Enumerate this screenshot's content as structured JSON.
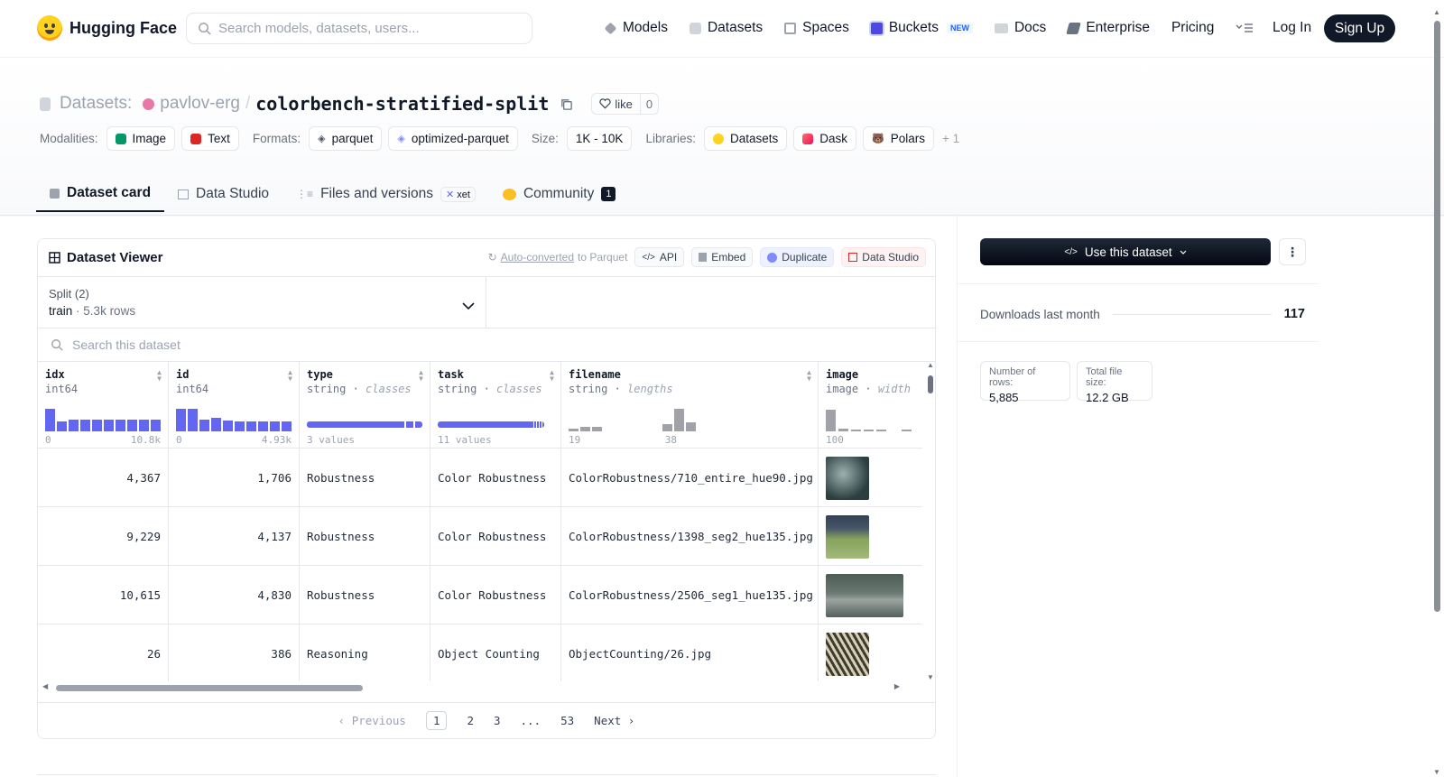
{
  "nav": {
    "brand": "Hugging Face",
    "search_placeholder": "Search models, datasets, users...",
    "links": [
      "Models",
      "Datasets",
      "Spaces",
      "Buckets",
      "Docs",
      "Enterprise",
      "Pricing"
    ],
    "new_badge": "NEW",
    "login": "Log In",
    "signup": "Sign Up"
  },
  "dataset": {
    "label": "Datasets:",
    "org": "pavlov-erg",
    "sep": "/",
    "name": "colorbench-stratified-split",
    "like_label": "like",
    "like_count": "0"
  },
  "tags": {
    "modalities_label": "Modalities:",
    "modalities": [
      "Image",
      "Text"
    ],
    "formats_label": "Formats:",
    "formats": [
      "parquet",
      "optimized-parquet"
    ],
    "size_label": "Size:",
    "size": "1K - 10K",
    "libraries_label": "Libraries:",
    "libraries": [
      "Datasets",
      "Dask",
      "Polars"
    ],
    "more": "+ 1"
  },
  "tabs": {
    "card": "Dataset card",
    "studio": "Data Studio",
    "files": "Files and versions",
    "xet": "xet",
    "community": "Community",
    "community_count": "1"
  },
  "viewer": {
    "title": "Dataset Viewer",
    "auto_converted": "Auto-converted",
    "to_parquet": "to Parquet",
    "api": "API",
    "embed": "Embed",
    "duplicate": "Duplicate",
    "data_studio": "Data Studio",
    "split_label": "Split (2)",
    "split_name": "train",
    "split_rows": "5.3k rows",
    "search_placeholder": "Search this dataset",
    "columns": [
      {
        "name": "idx",
        "type": "int64",
        "sub": "",
        "min": "0",
        "max": "10.8k"
      },
      {
        "name": "id",
        "type": "int64",
        "sub": "",
        "min": "0",
        "max": "4.93k"
      },
      {
        "name": "type",
        "type": "string",
        "sub": "classes",
        "min": "3 values",
        "max": ""
      },
      {
        "name": "task",
        "type": "string",
        "sub": "classes",
        "min": "11 values",
        "max": ""
      },
      {
        "name": "filename",
        "type": "string",
        "sub": "lengths",
        "min": "19",
        "max": "38"
      },
      {
        "name": "image",
        "type": "image",
        "sub": "width",
        "min": "100",
        "max": ""
      }
    ],
    "rows": [
      {
        "idx": "4,367",
        "id": "1,706",
        "type": "Robustness",
        "task": "Color Robustness",
        "filename": "ColorRobustness/710_entire_hue90.jpg",
        "img_color": "#3f5a5c"
      },
      {
        "idx": "9,229",
        "id": "4,137",
        "type": "Robustness",
        "task": "Color Robustness",
        "filename": "ColorRobustness/1398_seg2_hue135.jpg",
        "img_color": "#6e8a4a"
      },
      {
        "idx": "10,615",
        "id": "4,830",
        "type": "Robustness",
        "task": "Color Robustness",
        "filename": "ColorRobustness/2506_seg1_hue135.jpg",
        "img_color": "#5a6460"
      },
      {
        "idx": "26",
        "id": "386",
        "type": "Reasoning",
        "task": "Object Counting",
        "filename": "ObjectCounting/26.jpg",
        "img_color": "#8c7a4e"
      }
    ],
    "pager": {
      "prev": "Previous",
      "pages": [
        "1",
        "2",
        "3",
        "...",
        "53"
      ],
      "next": "Next"
    }
  },
  "sidebar": {
    "use_button": "Use this dataset",
    "downloads_label": "Downloads last month",
    "downloads_value": "117",
    "rows_label": "Number of rows:",
    "rows_value": "5,885",
    "size_label": "Total file size:",
    "size_value": "12.2 GB"
  },
  "colors": {
    "accent": "#6366f1",
    "dark": "#111827"
  }
}
